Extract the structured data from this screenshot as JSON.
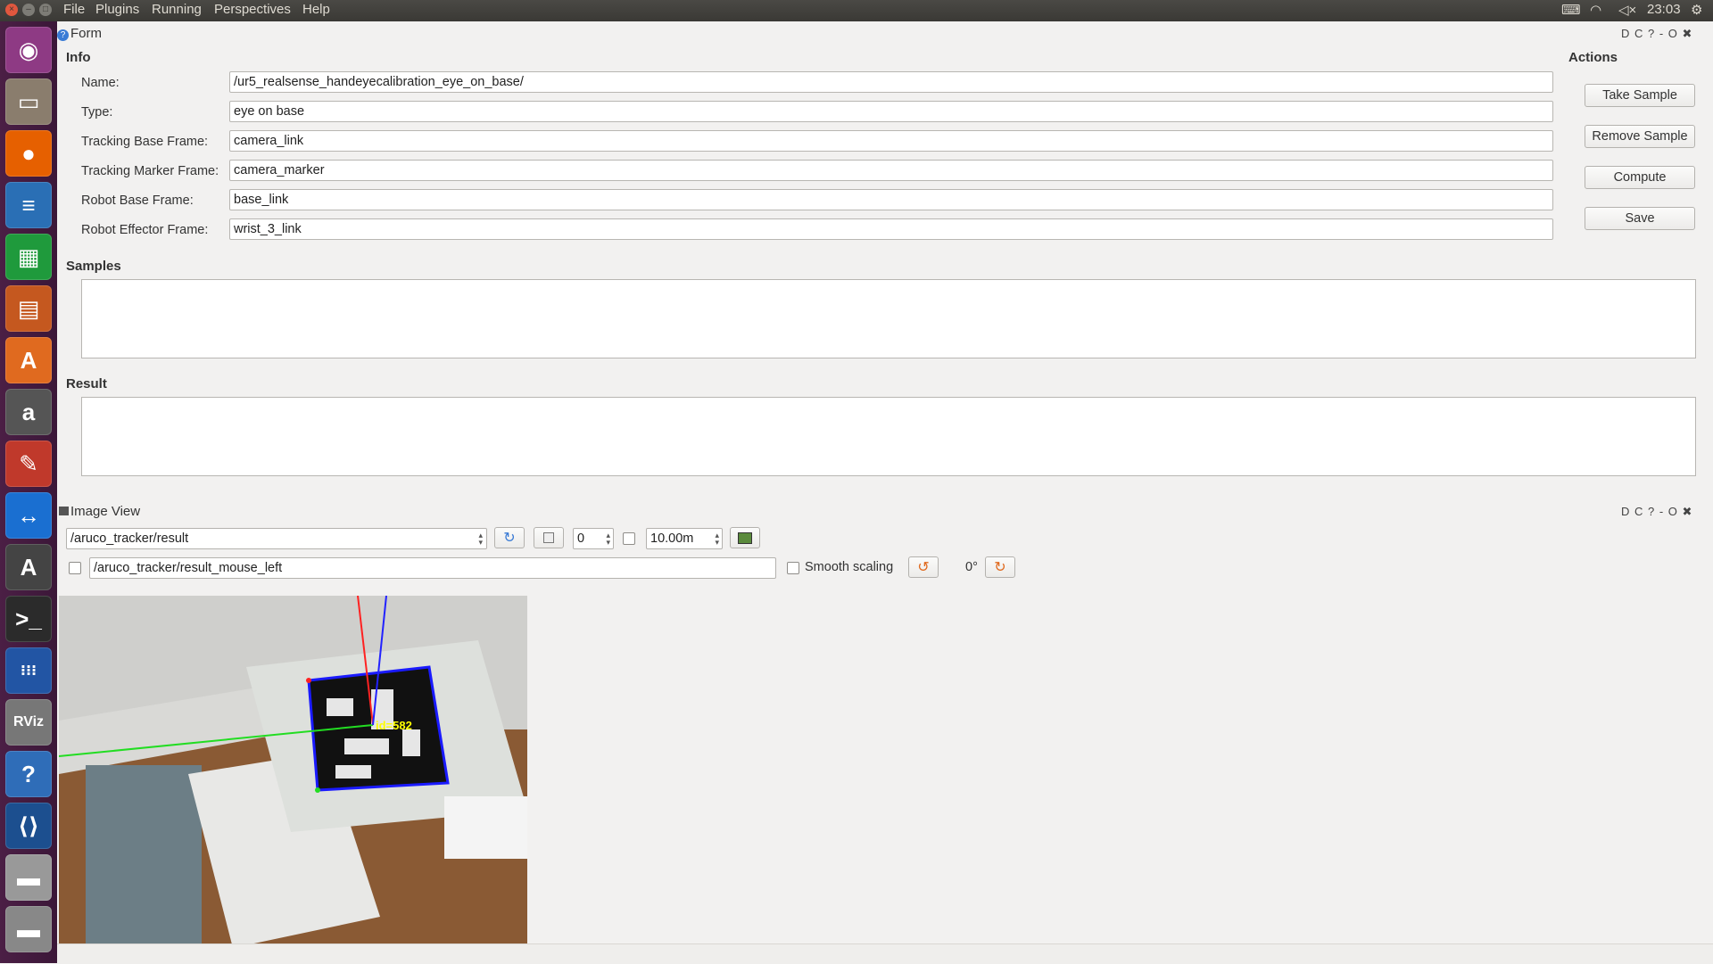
{
  "topbar": {
    "menus": [
      "File",
      "Plugins",
      "Running",
      "Perspectives",
      "Help"
    ],
    "clock": "23:03",
    "icons": [
      "keyboard-icon",
      "wifi-icon",
      "volume-muted-icon",
      "settings-gear-icon"
    ]
  },
  "launcher": {
    "items": [
      {
        "name": "ubuntu-dash-icon",
        "glyph": "◉",
        "color": "#8e3a84"
      },
      {
        "name": "files-icon",
        "glyph": "▭",
        "color": "#8a7d6d"
      },
      {
        "name": "firefox-icon",
        "glyph": "●",
        "color": "#e66000"
      },
      {
        "name": "writer-icon",
        "glyph": "≡",
        "color": "#2a6fb5"
      },
      {
        "name": "calc-icon",
        "glyph": "▦",
        "color": "#1f9a3c"
      },
      {
        "name": "impress-icon",
        "glyph": "▤",
        "color": "#c5581f"
      },
      {
        "name": "software-center-icon",
        "glyph": "A",
        "color": "#e06a1f"
      },
      {
        "name": "amazon-icon",
        "glyph": "a",
        "color": "#555"
      },
      {
        "name": "system-settings-icon",
        "glyph": "✎",
        "color": "#c0392b"
      },
      {
        "name": "teamviewer-icon",
        "glyph": "↔",
        "color": "#1a6fd1"
      },
      {
        "name": "software-updater-icon",
        "glyph": "A",
        "color": "#444"
      },
      {
        "name": "terminal-icon",
        "glyph": ">_",
        "color": "#2b2b2b"
      },
      {
        "name": "app-grid-icon",
        "glyph": "⁝⁝⁝",
        "color": "#2255a4"
      },
      {
        "name": "rviz-icon",
        "glyph": "RViz",
        "color": "#777"
      },
      {
        "name": "help-icon",
        "glyph": "?",
        "color": "#2f6db8"
      },
      {
        "name": "vscode-icon",
        "glyph": "⟨⟩",
        "color": "#1c4f8f"
      },
      {
        "name": "disk-icon",
        "glyph": "▬",
        "color": "#999"
      },
      {
        "name": "removable-disk-icon",
        "glyph": "▬",
        "color": "#888"
      }
    ]
  },
  "form": {
    "title": "Form",
    "info_label": "Info",
    "actions_label": "Actions",
    "fields": [
      {
        "label": "Name:",
        "value": "/ur5_realsense_handeyecalibration_eye_on_base/"
      },
      {
        "label": "Type:",
        "value": "eye on base"
      },
      {
        "label": "Tracking Base Frame:",
        "value": "camera_link"
      },
      {
        "label": "Tracking Marker Frame:",
        "value": "camera_marker"
      },
      {
        "label": "Robot Base Frame:",
        "value": "base_link"
      },
      {
        "label": "Robot Effector Frame:",
        "value": "wrist_3_link"
      }
    ],
    "actions": [
      "Take Sample",
      "Remove Sample",
      "Compute",
      "Save"
    ],
    "samples_label": "Samples",
    "result_label": "Result"
  },
  "image_view": {
    "title": "Image View",
    "topic": "/aruco_tracker/result",
    "spin_value": "0",
    "distance": "10.00m",
    "mouse_topic": "/aruco_tracker/result_mouse_left",
    "smooth_scaling_label": "Smooth scaling",
    "rotation": "0°",
    "marker_label": "id=582"
  },
  "dock_controls": "D C ?  - O ✖"
}
